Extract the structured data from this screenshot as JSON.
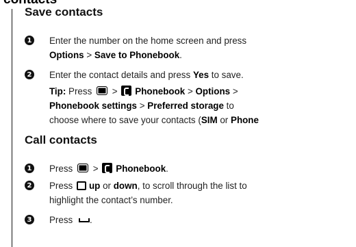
{
  "crop_heading": "contacts",
  "save_section": {
    "title": "Save contacts",
    "step1": {
      "number": "1",
      "line1": "Enter the number on the home screen and press",
      "options": "Options",
      "gt": ">",
      "save_to_phonebook": "Save to Phonebook",
      "period": "."
    },
    "step2": {
      "number": "2",
      "line1_pre": "Enter the contact details and press",
      "yes": "Yes",
      "line1_post": "to save."
    },
    "tip": {
      "label": "Tip:",
      "press": "Press",
      "gt": ">",
      "phonebook": "Phonebook",
      "options": "Options",
      "phonebook_settings": "Phonebook settings",
      "preferred_storage": "Preferred storage",
      "to": "to",
      "line3_pre": "choose where to save your contacts (",
      "sim": "SIM",
      "or": "or",
      "phone": "Phone"
    }
  },
  "call_section": {
    "title": "Call contacts",
    "step1": {
      "number": "1",
      "press": "Press",
      "gt": ">",
      "phonebook": "Phonebook",
      "period": "."
    },
    "step2": {
      "number": "2",
      "press": "Press",
      "up": "up",
      "or": "or",
      "down": "down",
      "line1_post": ", to scroll through the list to",
      "line2": "highlight the contact’s number."
    },
    "step3": {
      "number": "3",
      "press": "Press",
      "period": "."
    }
  },
  "icons": {
    "menu_key": "menu-key-icon",
    "phonebook": "phonebook-icon",
    "nav_key": "navigation-key-icon",
    "send_key": "send-key-icon"
  }
}
